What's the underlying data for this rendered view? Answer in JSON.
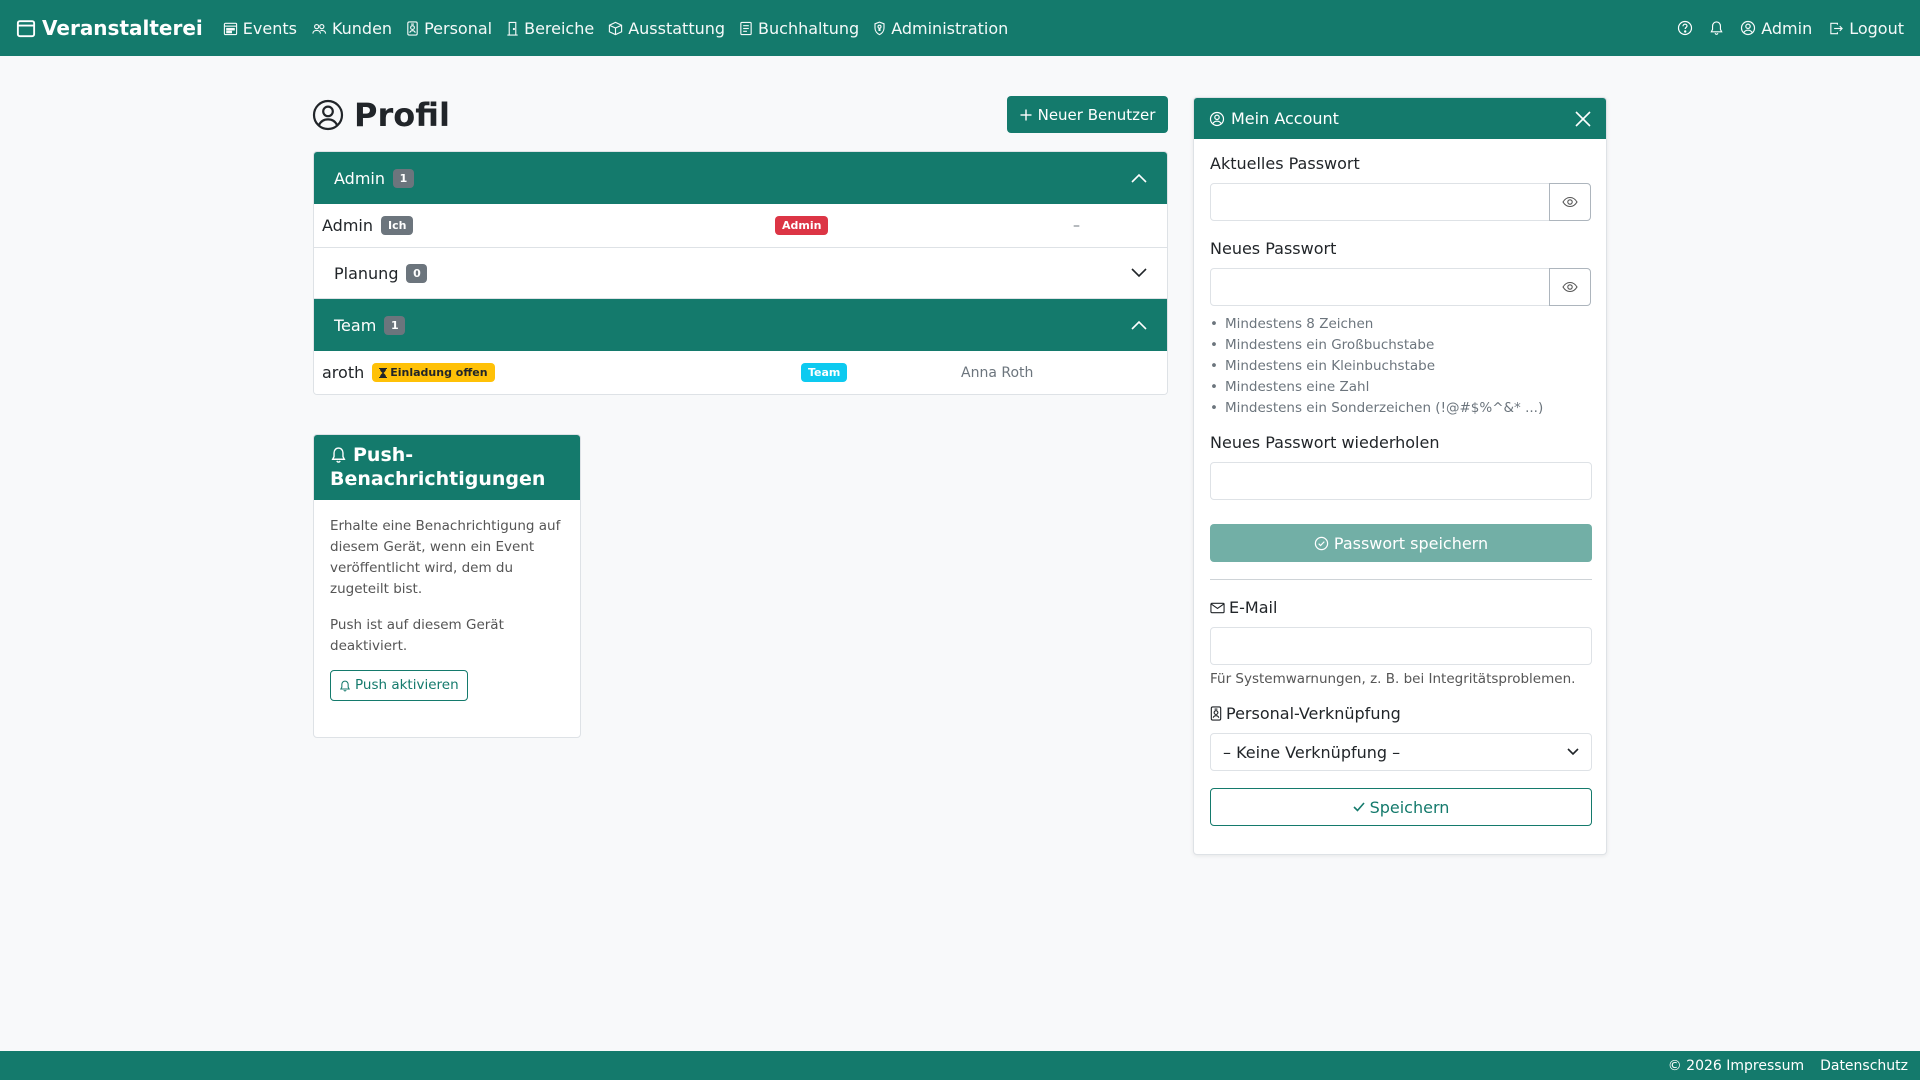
{
  "nav": {
    "brand": "Veranstalterei",
    "items": [
      {
        "label": "Events",
        "icon": "calendar-week-icon"
      },
      {
        "label": "Kunden",
        "icon": "people-icon"
      },
      {
        "label": "Personal",
        "icon": "person-badge-icon"
      },
      {
        "label": "Bereiche",
        "icon": "door-icon"
      },
      {
        "label": "Ausstattung",
        "icon": "box-icon"
      },
      {
        "label": "Buchhaltung",
        "icon": "journal-icon"
      },
      {
        "label": "Administration",
        "icon": "shield-icon"
      }
    ],
    "help_icon": "question-circle-icon",
    "bell_icon": "bell-icon",
    "user_label": "Admin",
    "logout_label": "Logout"
  },
  "page": {
    "title": "Profil",
    "new_user_button": "Neuer Benutzer"
  },
  "groups": [
    {
      "name": "Admin",
      "count": "1",
      "expanded": true,
      "rows": [
        {
          "user": "Admin",
          "tag": "Ich",
          "role": "Admin",
          "person": "–"
        }
      ]
    },
    {
      "name": "Planung",
      "count": "0",
      "expanded": false,
      "rows": []
    },
    {
      "name": "Team",
      "count": "1",
      "expanded": true,
      "rows": [
        {
          "user": "aroth",
          "tag": "Einladung offen",
          "role": "Team",
          "person": "Anna Roth"
        }
      ]
    }
  ],
  "push": {
    "title": "Push-Benachrichtigungen",
    "title_line1": "Push-",
    "title_line2": "Benachrichtigungen",
    "description": "Erhalte eine Benachrichtigung auf diesem Gerät, wenn ein Event veröffentlicht wird, dem du zugeteilt bist.",
    "status": "Push ist auf diesem Gerät deaktiviert.",
    "button": "Push aktivieren"
  },
  "account": {
    "title": "Mein Account",
    "current_password_label": "Aktuelles Passwort",
    "current_password_value": "",
    "new_password_label": "Neues Passwort",
    "new_password_value": "",
    "rules": [
      "Mindestens 8 Zeichen",
      "Mindestens ein Großbuchstabe",
      "Mindestens ein Kleinbuchstabe",
      "Mindestens eine Zahl",
      "Mindestens ein Sonderzeichen (!@#$%^&* ...)"
    ],
    "repeat_password_label": "Neues Passwort wiederholen",
    "repeat_password_value": "",
    "save_password_button": "Passwort speichern",
    "email_label": "E-Mail",
    "email_value": "",
    "email_hint": "Für Systemwarnungen, z. B. bei Integritätsproblemen.",
    "personal_link_label": "Personal-Verknüpfung",
    "personal_link_selected": "– Keine Verknüpfung –",
    "save_button": "Speichern"
  },
  "footer": {
    "copyright": "© 2026 Impressum",
    "privacy": "Datenschutz"
  },
  "colors": {
    "primary": "#147a6c",
    "primary_light": "#72afa6",
    "danger": "#dc3545",
    "warning": "#ffc107",
    "info": "#0dcaf0",
    "secondary": "#6c757d"
  }
}
